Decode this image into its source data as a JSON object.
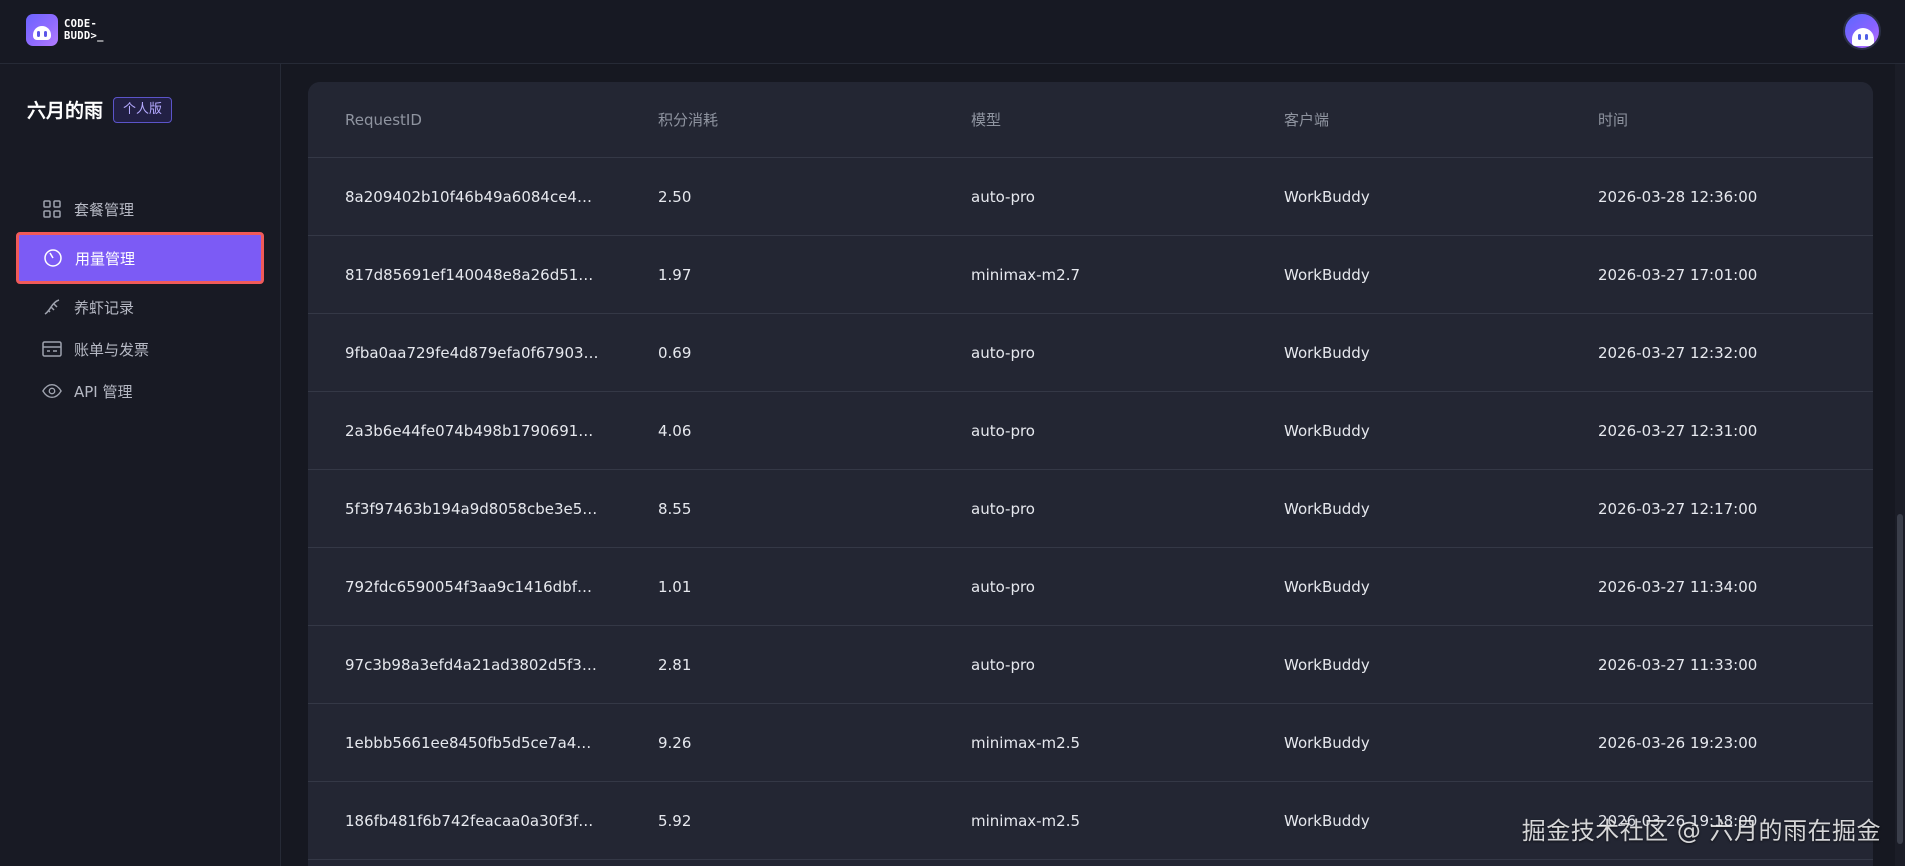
{
  "brand": {
    "logo_line1": "CODE-",
    "logo_line2": "BUDD>_"
  },
  "sidebar": {
    "user_name": "六月的雨",
    "plan_badge": "个人版",
    "items": [
      {
        "label": "套餐管理",
        "icon": "grid-icon"
      },
      {
        "label": "用量管理",
        "icon": "gauge-icon",
        "active": true
      },
      {
        "label": "养虾记录",
        "icon": "shrimp-icon"
      },
      {
        "label": "账单与发票",
        "icon": "invoice-icon"
      },
      {
        "label": "API 管理",
        "icon": "eye-icon"
      }
    ]
  },
  "table": {
    "columns": [
      "RequestID",
      "积分消耗",
      "模型",
      "客户端",
      "时间"
    ],
    "rows": [
      [
        "8a209402b10f46b49a6084ce4…",
        "2.50",
        "auto-pro",
        "WorkBuddy",
        "2026-03-28 12:36:00"
      ],
      [
        "817d85691ef140048e8a26d51…",
        "1.97",
        "minimax-m2.7",
        "WorkBuddy",
        "2026-03-27 17:01:00"
      ],
      [
        "9fba0aa729fe4d879efa0f67903…",
        "0.69",
        "auto-pro",
        "WorkBuddy",
        "2026-03-27 12:32:00"
      ],
      [
        "2a3b6e44fe074b498b1790691…",
        "4.06",
        "auto-pro",
        "WorkBuddy",
        "2026-03-27 12:31:00"
      ],
      [
        "5f3f97463b194a9d8058cbe3e5…",
        "8.55",
        "auto-pro",
        "WorkBuddy",
        "2026-03-27 12:17:00"
      ],
      [
        "792fdc6590054f3aa9c1416dbf…",
        "1.01",
        "auto-pro",
        "WorkBuddy",
        "2026-03-27 11:34:00"
      ],
      [
        "97c3b98a3efd4a21ad3802d5f3…",
        "2.81",
        "auto-pro",
        "WorkBuddy",
        "2026-03-27 11:33:00"
      ],
      [
        "1ebbb5661ee8450fb5d5ce7a4…",
        "9.26",
        "minimax-m2.5",
        "WorkBuddy",
        "2026-03-26 19:23:00"
      ],
      [
        "186fb481f6b742feacaa0a30f3f…",
        "5.92",
        "minimax-m2.5",
        "WorkBuddy",
        "2026-03-26 19:18:00"
      ]
    ]
  },
  "watermark": "掘金技术社区 @ 六月的雨在掘金",
  "colors": {
    "accent": "#7c5bf5",
    "highlight_border": "#f05a5a",
    "background": "#161821",
    "card": "#232633"
  }
}
